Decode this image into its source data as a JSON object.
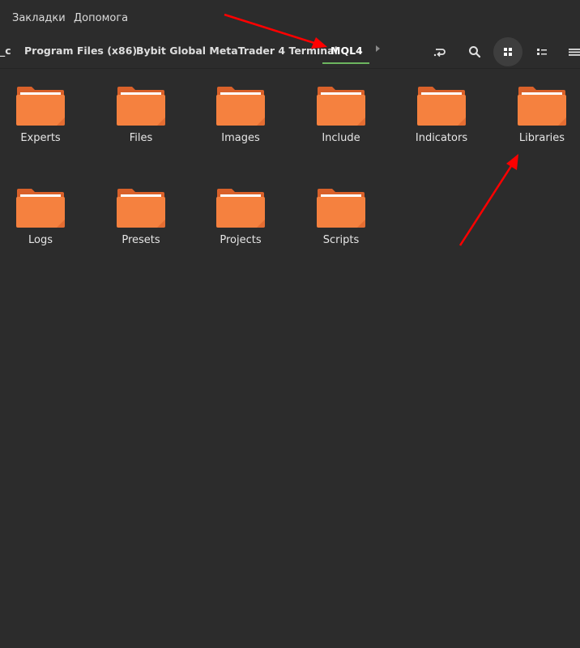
{
  "menu": {
    "bookmarks": "Закладки",
    "help": "Допомога"
  },
  "breadcrumbs": [
    "_c",
    "Program Files (x86)",
    "Bybit Global MetaTrader 4 Terminal",
    "MQL4"
  ],
  "toolbar": {
    "history_icon": "history-icon",
    "search_icon": "search-icon",
    "grid_icon": "grid-view-icon",
    "list_icon": "list-view-icon",
    "more_icon": "more-icon"
  },
  "folders": [
    "Experts",
    "Files",
    "Images",
    "Include",
    "Indicators",
    "Libraries",
    "Logs",
    "Presets",
    "Projects",
    "Scripts"
  ],
  "colors": {
    "folder_body": "#f5813f",
    "folder_back": "#d9612a",
    "folder_paper": "#ffffff",
    "accent": "#6cb55f",
    "annotation_arrow": "#ff0000"
  }
}
